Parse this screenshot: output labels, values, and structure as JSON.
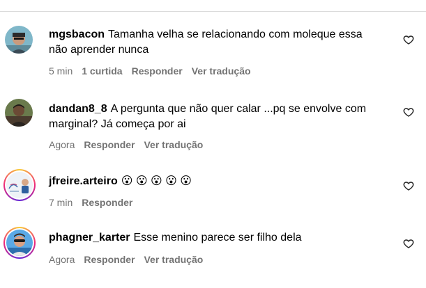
{
  "comments": [
    {
      "username": "mgsbacon",
      "text": "Tamanha velha se relacionando com moleque essa não aprender nunca",
      "time": "5 min",
      "likes": "1 curtida",
      "reply": "Responder",
      "translate": "Ver tradução"
    },
    {
      "username": "dandan8_8",
      "text": "A pergunta que não quer calar ...pq se envolve com marginal? Já começa por ai",
      "time": "Agora",
      "reply": "Responder",
      "translate": "Ver tradução"
    },
    {
      "username": "jfreire.arteiro",
      "text": "😮 😮 😮 😮 😮",
      "time": "7 min",
      "reply": "Responder"
    },
    {
      "username": "phagner_karter",
      "text": "Esse menino parece ser filho dela",
      "time": "Agora",
      "reply": "Responder",
      "translate": "Ver tradução"
    }
  ],
  "icons": {
    "like": "heart-outline-icon"
  },
  "colors": {
    "meta": "#737373",
    "divider": "#dbdbdb"
  }
}
